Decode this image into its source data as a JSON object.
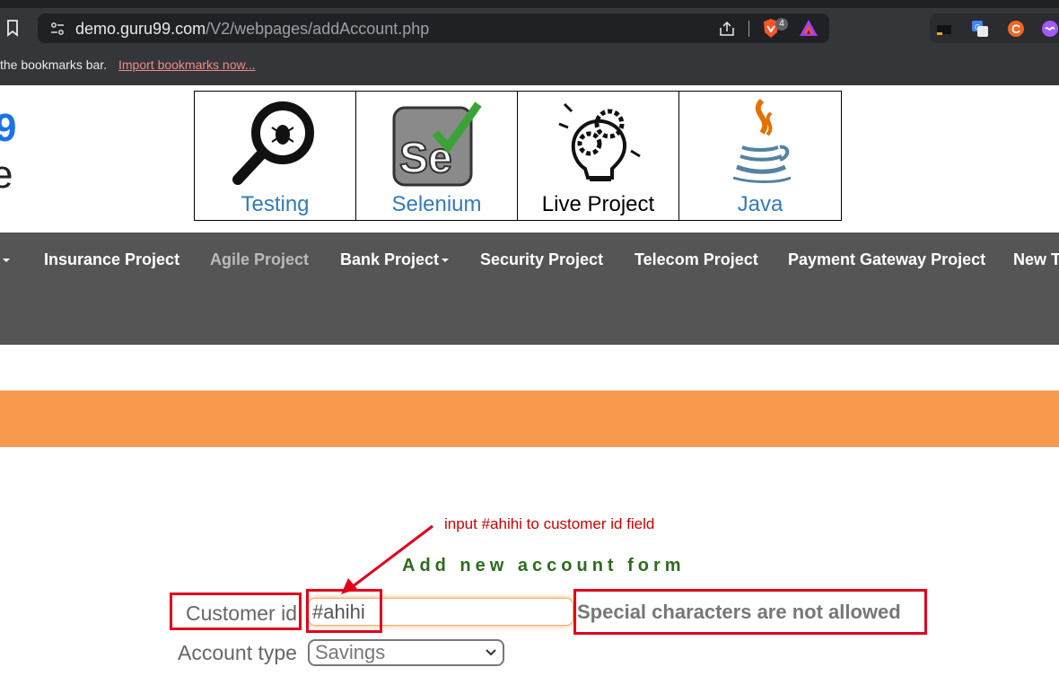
{
  "browser": {
    "url_host": "demo.guru99.com",
    "url_path": "/V2/webpages/addAccount.php",
    "brave_badge": "4",
    "bookmarks_text": "the bookmarks bar.",
    "bookmarks_link": "Import bookmarks now..."
  },
  "logo": {
    "frag1": "9",
    "frag2": "e"
  },
  "promo": [
    {
      "label": "Testing",
      "icon": "magnifier-bug-icon"
    },
    {
      "label": "Selenium",
      "icon": "selenium-icon"
    },
    {
      "label": "Live Project",
      "icon": "lightbulb-gears-icon"
    },
    {
      "label": "Java",
      "icon": "java-icon"
    }
  ],
  "nav": {
    "insurance": "Insurance Project",
    "agile": "Agile Project",
    "bank": "Bank Project",
    "security": "Security Project",
    "telecom": "Telecom Project",
    "payment": "Payment Gateway Project",
    "new": "New T"
  },
  "annotation": "input #ahihi to customer id field",
  "form": {
    "title": "Add new account form",
    "customer_id_label": "Customer id",
    "customer_id_value": "#ahihi",
    "error": "Special characters are not allowed",
    "account_type_label": "Account type",
    "account_type_value": "Savings"
  },
  "colors": {
    "nav_bg": "#555555",
    "orange_band": "#f79a4f",
    "annotation_red": "#e0001b",
    "title_green": "#2e6b1f"
  }
}
